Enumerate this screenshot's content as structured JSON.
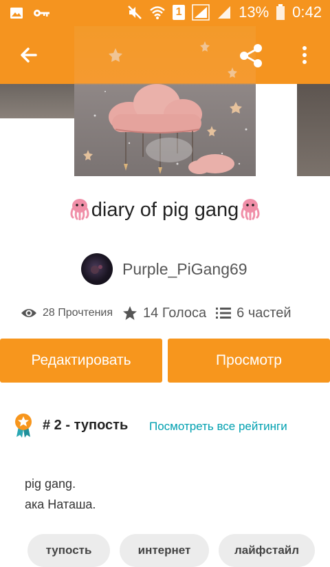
{
  "status_bar": {
    "battery_percent": "13%",
    "time": "0:42",
    "sim_label": "1"
  },
  "story": {
    "title": "diary of pig gang",
    "title_emoji": "octopus",
    "author": "Purple_PiGang69",
    "stats": {
      "reads": "28 Прочтения",
      "votes": "14 Голоса",
      "parts": "6 частей"
    }
  },
  "actions": {
    "edit_label": "Редактировать",
    "view_label": "Просмотр"
  },
  "ranking": {
    "rank_text": "# 2 - тупость",
    "link_text": "Посмотреть все рейтинги"
  },
  "description": {
    "line1": "pig gang.",
    "line2": "ака Наташа."
  },
  "tags": [
    "тупость",
    "интернет",
    "лайфстайл"
  ],
  "colors": {
    "accent": "#f5941f",
    "link": "#00a0b0"
  },
  "icons": {
    "back": "arrow-left-icon",
    "share": "share-icon",
    "more": "more-vert-icon",
    "reads": "eye-icon",
    "votes": "star-icon",
    "parts": "list-icon",
    "rank": "award-badge-icon"
  }
}
